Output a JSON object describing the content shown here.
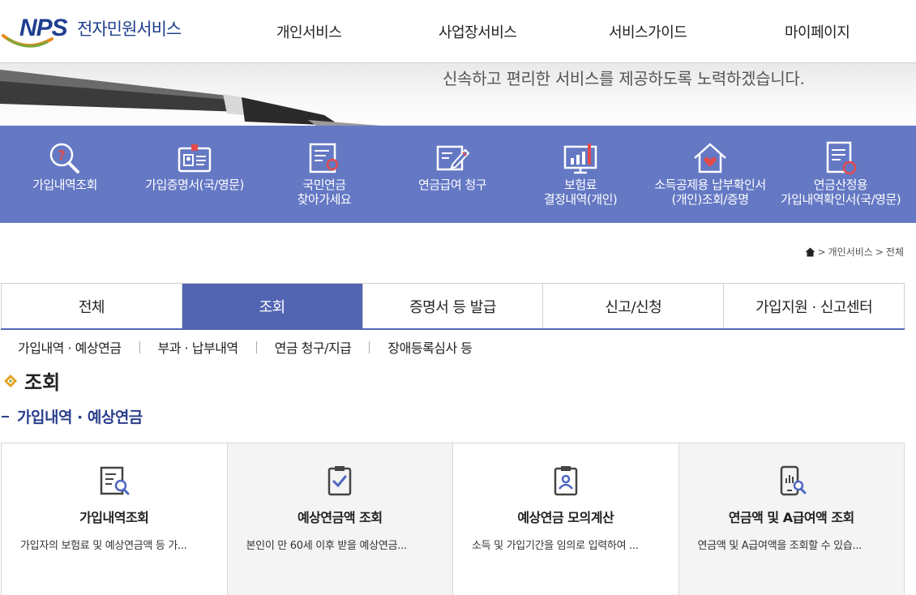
{
  "header": {
    "logo_mark": "NPS",
    "logo_text": "전자민원서비스",
    "nav": [
      "개인서비스",
      "사업장서비스",
      "서비스가이드",
      "마이페이지"
    ]
  },
  "banner": {
    "text": "신속하고 편리한 서비스를 제공하도록 노력하겠습니다."
  },
  "quick_menu": [
    {
      "label": "가입내역조회",
      "icon": "magnifier-question-icon"
    },
    {
      "label": "가입증명서(국/영문)",
      "icon": "id-card-icon"
    },
    {
      "label": "국민연금\n찾아가세요",
      "icon": "document-search-icon"
    },
    {
      "label": "연금급여 청구",
      "icon": "form-pen-icon"
    },
    {
      "label": "보험료\n결정내역(개인)",
      "icon": "monitor-chart-icon"
    },
    {
      "label": "소득공제용 납부확인서\n(개인)조회/증명",
      "icon": "house-heart-icon"
    },
    {
      "label": "연금산정용\n가입내역확인서(국/영문)",
      "icon": "document-check-icon"
    }
  ],
  "breadcrumb": [
    "개인서비스",
    "전체"
  ],
  "tabs": [
    "전체",
    "조회",
    "증명서 등 발급",
    "신고/신청",
    "가입지원 · 신고센터"
  ],
  "active_tab": "조회",
  "subtabs": [
    "가입내역 · 예상연금",
    "부과 · 납부내역",
    "연금 청구/지급",
    "장애등록심사 등"
  ],
  "section": {
    "title": "조회",
    "subtitle": "가입내역 · 예상연금"
  },
  "cards": [
    {
      "title": "가입내역조회",
      "desc": "가입자의 보험료 및 예상연금액 등 가...",
      "icon": "document-search-icon"
    },
    {
      "title": "예상연금액 조회",
      "desc": "본인이 만 60세 이후 받을 예상연금...",
      "icon": "clipboard-check-icon"
    },
    {
      "title": "예상연금 모의계산",
      "desc": "소득 및 가입기간을 임의로 입력하여 ...",
      "icon": "clipboard-person-icon"
    },
    {
      "title": "연금액 및 A급여액 조회",
      "desc": "연금액 및 A급여액을 조회할 수 있습...",
      "icon": "phone-chart-search-icon"
    }
  ],
  "colors": {
    "brand_blue": "#1f3f8f",
    "quick_bg": "#6478c4",
    "tab_active": "#5265b3",
    "accent_orange": "#e58a1f",
    "accent_green": "#7aa83a"
  }
}
